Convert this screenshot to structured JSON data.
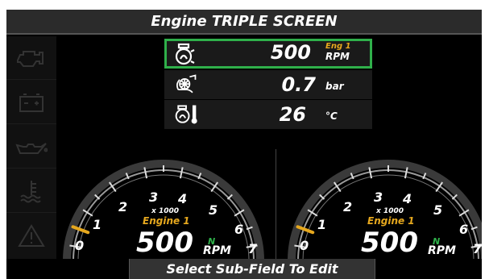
{
  "title": "Engine TRIPLE SCREEN",
  "sidebar": {
    "items": [
      {
        "icon": "check-engine-icon"
      },
      {
        "icon": "battery-icon"
      },
      {
        "icon": "oil-can-icon"
      },
      {
        "icon": "coolant-temperature-icon"
      },
      {
        "icon": "warning-triangle-icon"
      }
    ]
  },
  "fields": [
    {
      "icon": "engine-icon",
      "value": "500",
      "unit_top": "Eng 1",
      "unit_bottom": "RPM",
      "selected": true
    },
    {
      "icon": "turbo-boost-icon",
      "value": "0.7",
      "unit": "bar"
    },
    {
      "icon": "engine-temperature-icon",
      "value": "26",
      "unit": "°C"
    }
  ],
  "gauges": [
    {
      "ticks": [
        "0",
        "1",
        "2",
        "3",
        "4",
        "5",
        "6",
        "7"
      ],
      "multiplier": "x 1000",
      "engine_label": "Engine 1",
      "value": "500",
      "gear": "N",
      "unit": "RPM",
      "needle_fraction": 0.07
    },
    {
      "ticks": [
        "0",
        "1",
        "2",
        "3",
        "4",
        "5",
        "6",
        "7"
      ],
      "multiplier": "x 1000",
      "engine_label": "Engine 1",
      "value": "500",
      "gear": "N",
      "unit": "RPM",
      "needle_fraction": 0.07
    }
  ],
  "footer": "Select Sub-Field To Edit",
  "colors": {
    "accent_selected": "#2fb04a",
    "engine_label": "#e6a81e",
    "gear_indicator": "#2fb04a"
  }
}
